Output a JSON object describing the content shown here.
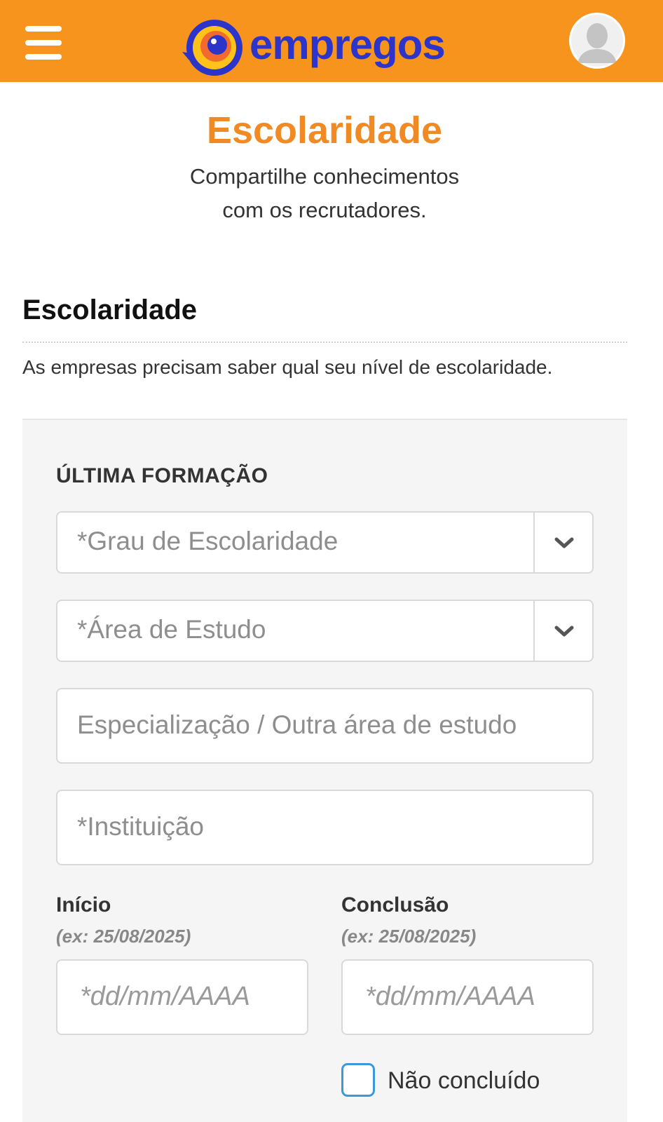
{
  "header": {
    "brand": "empregos",
    "colors": {
      "bar": "#f7941d",
      "brand_text": "#2d34c9"
    },
    "menu_icon": "hamburger-icon",
    "avatar_icon": "user-silhouette-icon"
  },
  "hero": {
    "title": "Escolaridade",
    "subtitle_line1": "Compartilhe conhecimentos",
    "subtitle_line2": "com os recrutadores."
  },
  "section": {
    "title": "Escolaridade",
    "description": "As empresas precisam saber qual seu nível de escolaridade."
  },
  "form": {
    "heading": "ÚLTIMA FORMAÇÃO",
    "grau_placeholder": "*Grau de Escolaridade",
    "area_placeholder": "*Área de Estudo",
    "especializacao_placeholder": "Especialização / Outra área de estudo",
    "instituicao_placeholder": "*Instituição",
    "inicio": {
      "label": "Início",
      "hint": "(ex: 25/08/2025)",
      "placeholder": "*dd/mm/AAAA"
    },
    "conclusao": {
      "label": "Conclusão",
      "hint": "(ex: 25/08/2025)",
      "placeholder": "*dd/mm/AAAA"
    },
    "nao_concluido_label": "Não concluído"
  }
}
